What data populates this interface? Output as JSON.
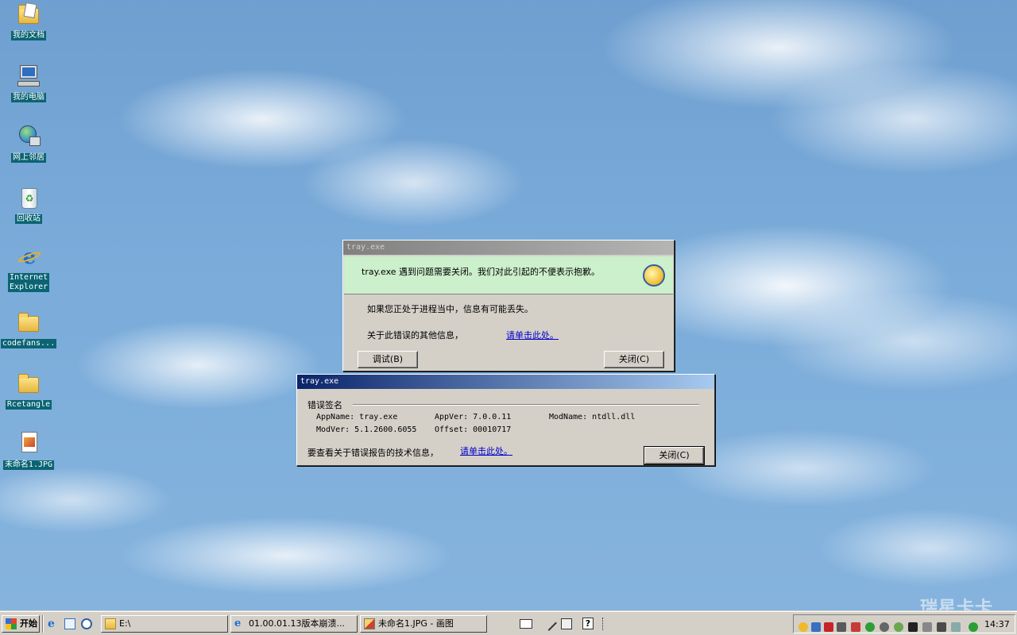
{
  "desktop": {
    "icons": [
      {
        "label": "我的文档",
        "icon": "my-documents-icon"
      },
      {
        "label": "我的电脑",
        "icon": "my-computer-icon"
      },
      {
        "label": "网上邻居",
        "icon": "network-icon"
      },
      {
        "label": "回收站",
        "icon": "recycle-bin-icon"
      },
      {
        "label": "Internet Explorer",
        "icon": "ie-icon"
      },
      {
        "label": "codefans...",
        "icon": "folder-icon"
      },
      {
        "label": "Rcetangle",
        "icon": "folder-icon"
      },
      {
        "label": "未命名1.JPG",
        "icon": "image-file-icon"
      }
    ],
    "watermark": "瑞星卡卡"
  },
  "error_dialog": {
    "title": "tray.exe",
    "header_message": "tray.exe 遇到问题需要关闭。我们对此引起的不便表示抱歉。",
    "line1": "如果您正处于进程当中，信息有可能丢失。",
    "line2": "关于此错误的其他信息，",
    "link": "请单击此处。",
    "debug_button": "调试(B)",
    "close_button": "关闭(C)"
  },
  "signature_dialog": {
    "title": "tray.exe",
    "section_label": "错误签名",
    "fields": {
      "appname": "AppName: tray.exe",
      "appver": "AppVer: 7.0.0.11",
      "modname": "ModName: ntdll.dll",
      "modver": "ModVer: 5.1.2600.6055",
      "offset": "Offset: 00010717"
    },
    "tech_text": "要查看关于错误报告的技术信息，",
    "link": "请单击此处。",
    "close_button": "关闭(C)"
  },
  "taskbar": {
    "start_label": "开始",
    "tasks": [
      {
        "label": "E:\\",
        "icon": "folder-icon"
      },
      {
        "label": "01.00.01.13版本崩溃...",
        "icon": "ie-icon"
      },
      {
        "label": "未命名1.JPG - 画图",
        "icon": "paint-icon"
      }
    ],
    "clock": "14:37"
  }
}
